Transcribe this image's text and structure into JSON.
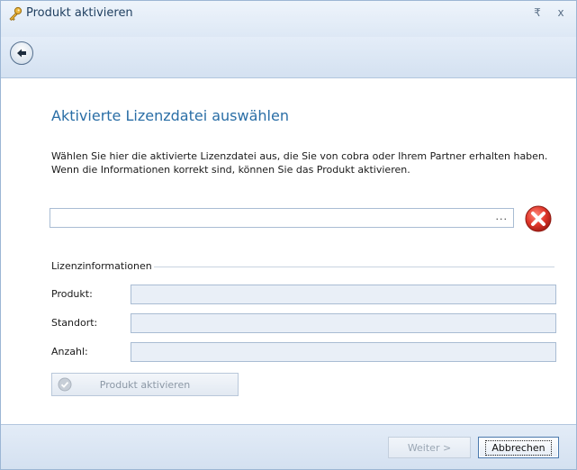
{
  "window": {
    "title": "Produkt aktivieren",
    "icon": "key-icon",
    "pin_glyph": "₹",
    "close_glyph": "x"
  },
  "nav": {
    "back_icon": "arrow-left-icon"
  },
  "page": {
    "heading": "Aktivierte Lizenzdatei auswählen",
    "description": "Wählen Sie hier die aktivierte Lizenzdatei aus, die Sie von cobra oder Ihrem Partner erhalten haben. Wenn die Informationen korrekt sind, können Sie das Produkt aktivieren."
  },
  "file_picker": {
    "value": "",
    "placeholder": "",
    "browse_label": "...",
    "status_icon": "error-icon"
  },
  "license_info": {
    "group_label": "Lizenzinformationen",
    "fields": [
      {
        "label": "Produkt:",
        "value": ""
      },
      {
        "label": "Standort:",
        "value": ""
      },
      {
        "label": "Anzahl:",
        "value": ""
      }
    ]
  },
  "actions": {
    "activate_label": "Produkt aktivieren",
    "activate_enabled": false
  },
  "footer": {
    "next_label": "Weiter >",
    "next_enabled": false,
    "cancel_label": "Abbrechen"
  },
  "colors": {
    "accent": "#2a6ea6",
    "error": "#d9332b",
    "frame": "#9cb6d4"
  }
}
